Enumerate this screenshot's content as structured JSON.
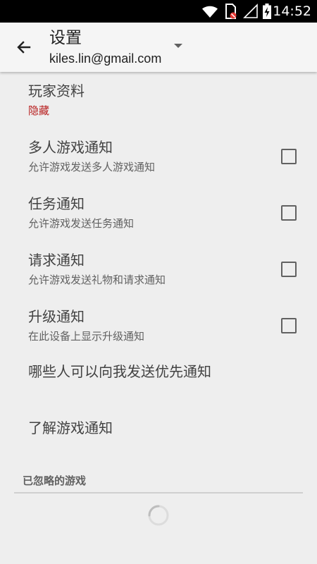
{
  "status_bar": {
    "time": "14:52",
    "icons": [
      "wifi-icon",
      "sim-no-signal-icon",
      "cell-signal-icon",
      "battery-charging-icon"
    ]
  },
  "app_bar": {
    "title": "设置",
    "account_email": "kiles.lin@gmail.com",
    "back_icon": "arrow-left-icon",
    "dropdown_icon": "caret-down-icon"
  },
  "settings": {
    "player_profile": {
      "title": "玩家资料",
      "summary": "隐藏"
    },
    "multiplayer": {
      "title": "多人游戏通知",
      "summary": "允许游戏发送多人游戏通知",
      "checked": false
    },
    "quests": {
      "title": "任务通知",
      "summary": "允许游戏发送任务通知",
      "checked": false
    },
    "requests": {
      "title": "请求通知",
      "summary": "允许游戏发送礼物和请求通知",
      "checked": false
    },
    "level_up": {
      "title": "升级通知",
      "summary": "在此设备上显示升级通知",
      "checked": false
    },
    "priority": {
      "title": "哪些人可以向我发送优先通知"
    },
    "learn_more": {
      "title": "了解游戏通知"
    }
  },
  "ignored_games": {
    "header": "已忽略的游戏"
  },
  "colors": {
    "status_bar_bg": "#000000",
    "app_bar_bg": "#f5f5f5",
    "page_bg": "#eeeeee",
    "accent_red": "#b71c1c",
    "text_primary": "#424242",
    "text_secondary": "#616161"
  }
}
